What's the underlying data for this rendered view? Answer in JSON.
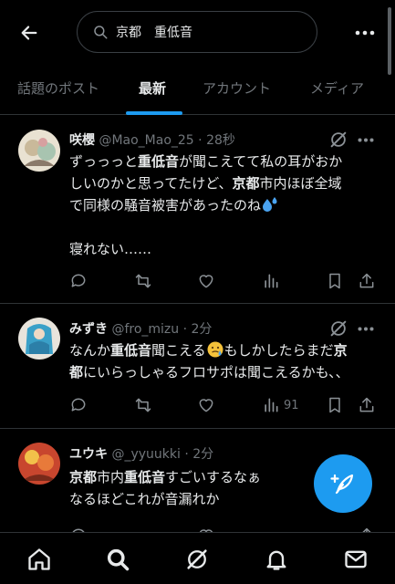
{
  "search": {
    "query": "京都　重低音"
  },
  "tabs": [
    {
      "label": "話題のポスト",
      "active": false
    },
    {
      "label": "最新",
      "active": true
    },
    {
      "label": "アカウント",
      "active": false
    },
    {
      "label": "メディア",
      "active": false
    }
  ],
  "colors": {
    "accent": "#1d9bf0",
    "muted": "#71767b",
    "text": "#e7e9ea",
    "background": "#000000"
  },
  "tweets": [
    {
      "name": "咲櫻",
      "handle": "@Mao_Mao_25 · 28秒",
      "lines": [
        [
          "ずっっっと",
          {
            "b": "重低音"
          },
          "が聞こえてて私の耳がおか"
        ],
        [
          "しいのかと思ってたけど、",
          {
            "b": "京都"
          },
          "市内ほぼ全域"
        ],
        [
          "で同様の騒音被害があったのね"
        ],
        [
          ""
        ],
        [
          "寝れない……"
        ]
      ],
      "views": ""
    },
    {
      "name": "みずき",
      "handle": "@fro_mizu · 2分",
      "lines": [
        [
          "なんか",
          {
            "b": "重低音"
          },
          "聞こえる",
          "もしかしたらまだ",
          {
            "b": "京"
          }
        ],
        [
          {
            "b": "都"
          },
          "にいらっしゃるフロサポは聞こえるかも、、"
        ]
      ],
      "views": "91"
    },
    {
      "name": "ユウキ",
      "handle": "@_yyuukki · 2分",
      "lines": [
        [
          {
            "b": "京都"
          },
          "市内",
          {
            "b": "重低音"
          },
          "すごいするなぁ"
        ],
        [
          "なるほどこれが音漏れか"
        ]
      ],
      "views": ""
    }
  ],
  "icons": {
    "back": "arrow-left-icon",
    "search": "search-icon",
    "more": "more-horizontal-icon",
    "grok": "grok-icon",
    "reply": "reply-icon",
    "repost": "repost-icon",
    "like": "like-icon",
    "views": "views-icon",
    "bookmark": "bookmark-icon",
    "share": "share-icon",
    "compose": "compose-post-icon",
    "home": "home-icon",
    "explore": "search-icon",
    "grok_nav": "grok-icon",
    "notifications": "bell-icon",
    "messages": "mail-icon"
  }
}
